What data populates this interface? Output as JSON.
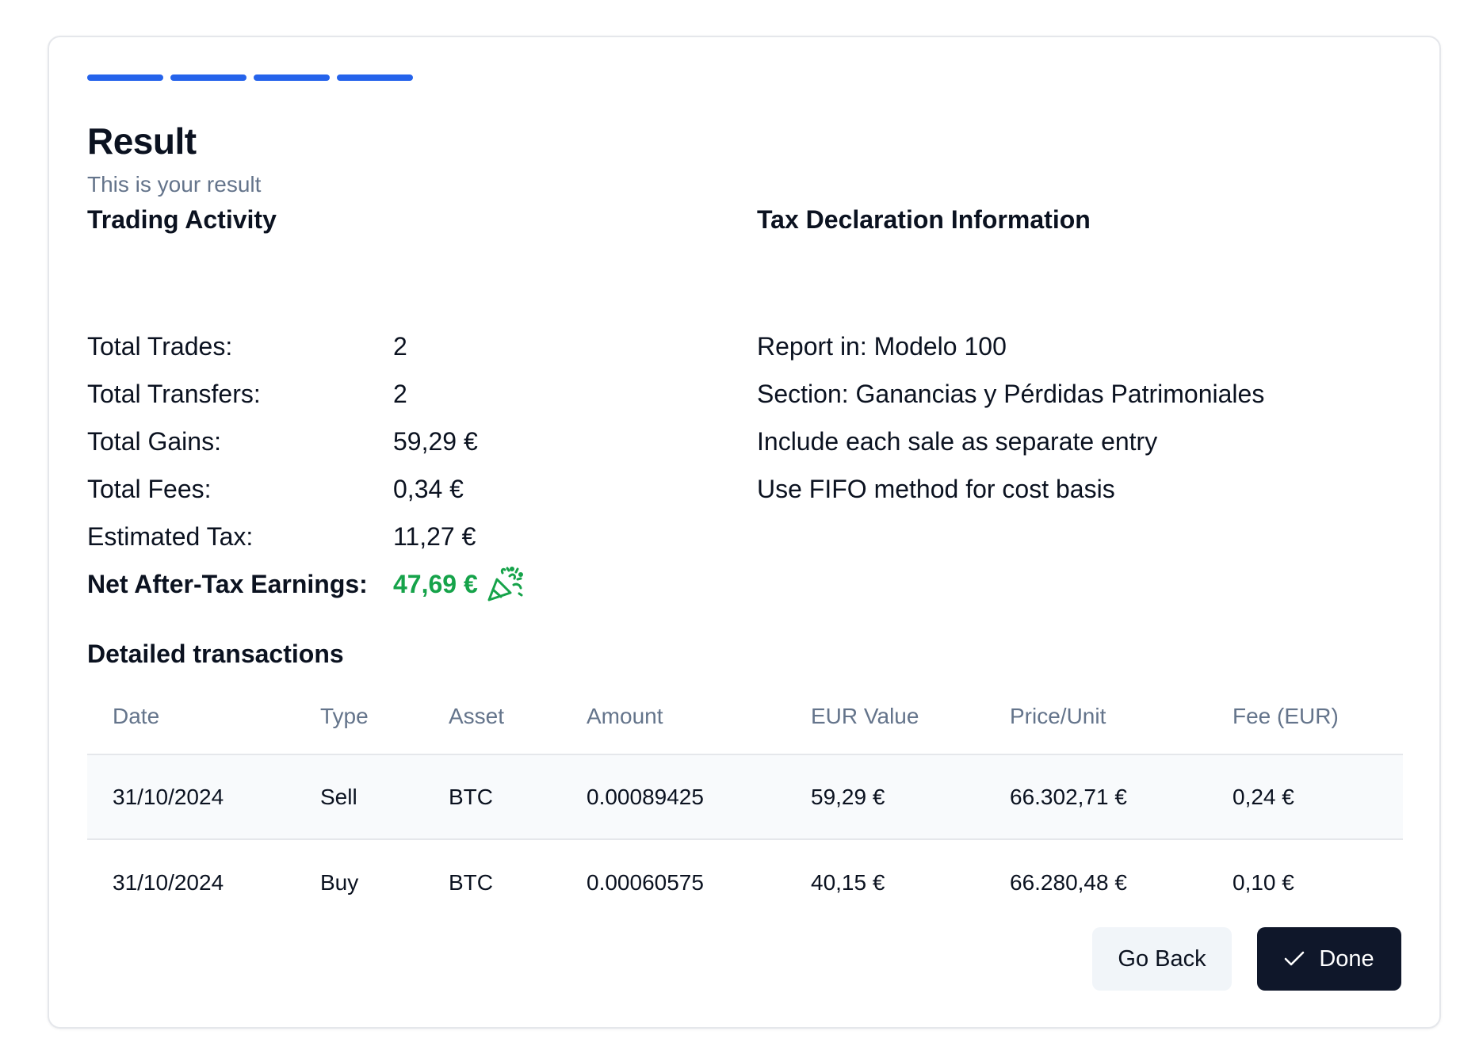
{
  "progress": {
    "steps_total": 4,
    "steps_completed": 4,
    "accent_color": "#2563eb"
  },
  "header": {
    "title": "Result",
    "subtitle": "This is your result"
  },
  "trading_activity": {
    "heading": "Trading Activity",
    "rows": [
      {
        "label": "Total Trades:",
        "value": "2"
      },
      {
        "label": "Total Transfers:",
        "value": "2"
      },
      {
        "label": "Total Gains:",
        "value": "59,29 €"
      },
      {
        "label": "Total Fees:",
        "value": "0,34 €"
      },
      {
        "label": "Estimated Tax:",
        "value": "11,27 €"
      }
    ],
    "net": {
      "label": "Net After-Tax Earnings:",
      "value": "47,69 €",
      "icon": "party-popper-icon",
      "color": "#16a34a"
    }
  },
  "tax_declaration": {
    "heading": "Tax Declaration Information",
    "items": [
      "Report in: Modelo 100",
      "Section: Ganancias y Pérdidas Patrimoniales",
      "Include each sale as separate entry",
      "Use FIFO method for cost basis"
    ]
  },
  "transactions": {
    "heading": "Detailed transactions",
    "columns": [
      "Date",
      "Type",
      "Asset",
      "Amount",
      "EUR Value",
      "Price/Unit",
      "Fee (EUR)"
    ],
    "rows": [
      [
        "31/10/2024",
        "Sell",
        "BTC",
        "0.00089425",
        "59,29 €",
        "66.302,71 €",
        "0,24 €"
      ],
      [
        "31/10/2024",
        "Buy",
        "BTC",
        "0.00060575",
        "40,15 €",
        "66.280,48 €",
        "0,10 €"
      ]
    ]
  },
  "actions": {
    "back_label": "Go Back",
    "done_label": "Done",
    "done_icon": "check-icon"
  }
}
